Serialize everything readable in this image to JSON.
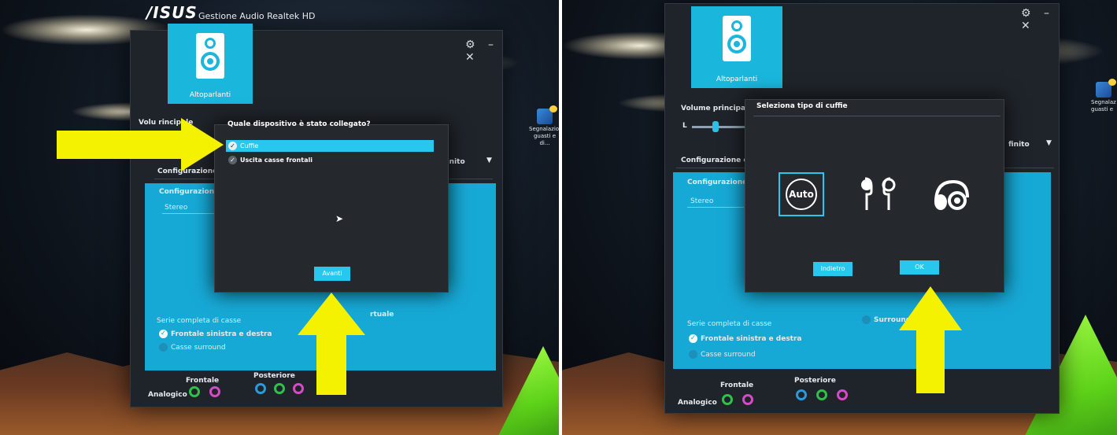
{
  "app": {
    "brand_logo": "/ISUS",
    "title": "Gestione Audio Realtek HD",
    "window_controls": "⚙ – ✕"
  },
  "device_tile": {
    "label": "Altoparlanti",
    "icon": "speaker-icon"
  },
  "main": {
    "volume_label": "Volume principale",
    "volume_label_partial_left": "Volu    rincipale",
    "volume_l": "L",
    "dropdown_value": "finito",
    "dropdown_value_left": "finito",
    "config_tab": "Configurazione cas",
    "config_header": "Configurazione c",
    "config_select": "Stereo",
    "full_range_title": "Serie completa di casse",
    "front_lr": "Frontale sinistra e destra",
    "surround_speakers": "Casse surround",
    "virtual_surround_left": "rtuale",
    "virtual_surround_right": "Surround",
    "analog_label": "Analogico",
    "front_label": "Frontale",
    "rear_label": "Posteriore"
  },
  "desktop_icon": {
    "label_left": "Segnalazioni guasti e di...",
    "label_right": "Segnalaz guasti e"
  },
  "dialog_left": {
    "title": "Quale dispositivo è stato collegato?",
    "options": [
      {
        "label": "Cuffie",
        "selected": true
      },
      {
        "label": "Uscita casse frontali",
        "selected": false
      }
    ],
    "next_button": "Avanti"
  },
  "dialog_right": {
    "title": "Seleziona tipo di cuffie",
    "options": [
      {
        "label": "Auto",
        "icon": "auto-icon",
        "selected": true
      },
      {
        "label": "",
        "icon": "earbuds-icon",
        "selected": false
      },
      {
        "label": "",
        "icon": "headphones-icon",
        "selected": false
      }
    ],
    "back_button": "Indietro",
    "ok_button": "OK"
  },
  "colors": {
    "accent": "#17a9d6",
    "button": "#28c8ee",
    "arrow": "#f5f200",
    "jack_blue": "#2a9ad8",
    "jack_green": "#2ec24a",
    "jack_pink": "#d64ac8"
  }
}
